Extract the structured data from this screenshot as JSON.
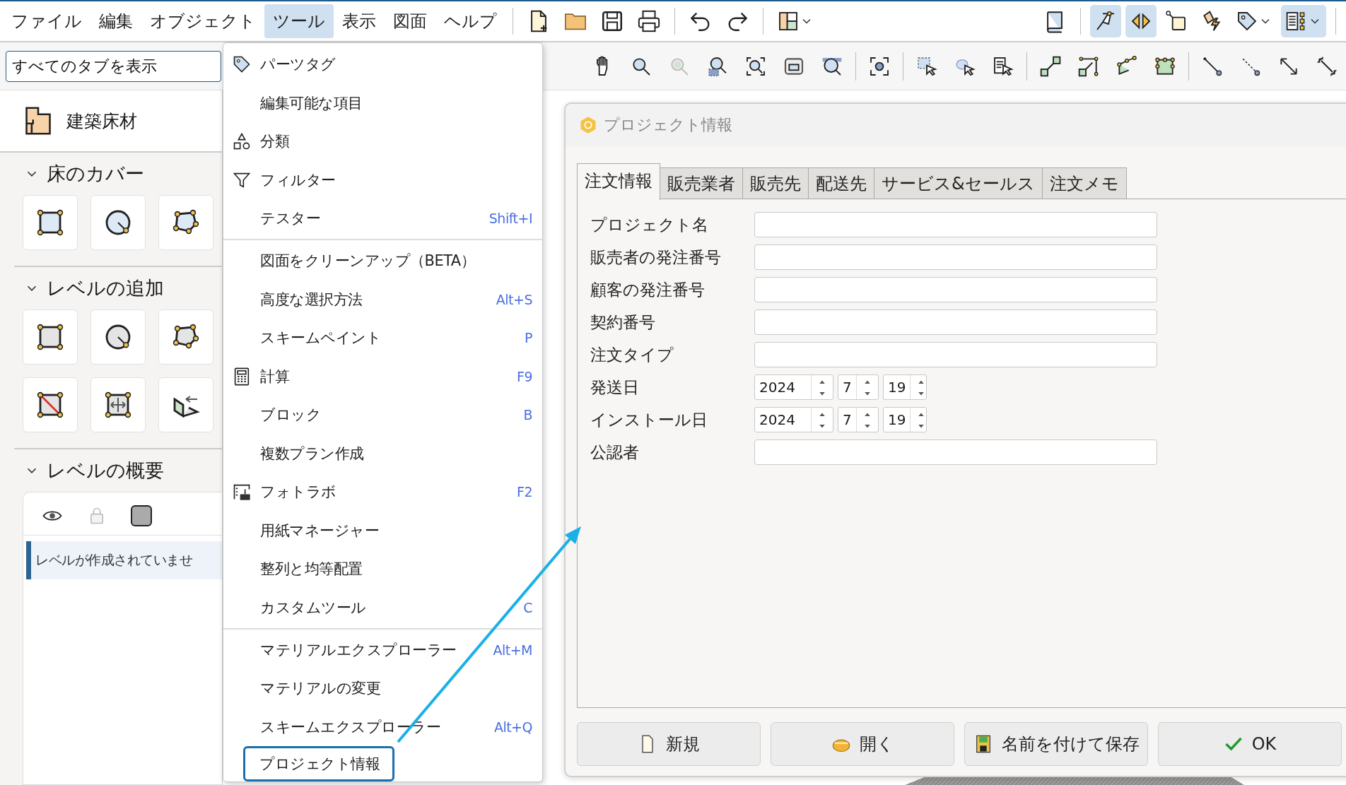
{
  "menu_bar": [
    {
      "label": "ファイル",
      "selected": false
    },
    {
      "label": "編集",
      "selected": false
    },
    {
      "label": "オブジェクト",
      "selected": false
    },
    {
      "label": "ツール",
      "selected": true
    },
    {
      "label": "表示",
      "selected": false
    },
    {
      "label": "図面",
      "selected": false
    },
    {
      "label": "ヘルプ",
      "selected": false
    }
  ],
  "toolbar": {
    "toggles": [
      {
        "selected": false
      },
      {
        "selected": true
      },
      {
        "selected": true
      },
      {
        "selected": false
      },
      {
        "selected": false
      },
      {
        "selected": false
      },
      {
        "selected": true
      }
    ]
  },
  "search": {
    "value": "すべてのタブを表示"
  },
  "sidebar": {
    "title": "建築床材",
    "sections": [
      {
        "title": "床のカバー",
        "expanded": true,
        "kind": "tools"
      },
      {
        "title": "レベルの追加",
        "expanded": true,
        "kind": "tools"
      },
      {
        "title": "レベルの概要",
        "expanded": true,
        "kind": "levels",
        "message": "レベルが作成されていませ"
      }
    ]
  },
  "tools_menu": {
    "sections": [
      {
        "items": [
          {
            "label": "パーツタグ",
            "selected": false
          },
          {
            "label": "編集可能な項目",
            "selected": false
          },
          {
            "label": "分類",
            "selected": false
          },
          {
            "label": "フィルター",
            "selected": false
          },
          {
            "label": "テスター",
            "shortcut": "Shift+I",
            "selected": false
          }
        ]
      },
      {
        "items": [
          {
            "label": "図面をクリーンアップ（BETA）",
            "selected": false
          },
          {
            "label": "高度な選択方法",
            "shortcut": "Alt+S",
            "selected": false
          },
          {
            "label": "スキームペイント",
            "shortcut": "P",
            "selected": false
          },
          {
            "label": "計算",
            "shortcut": "F9",
            "selected": false
          },
          {
            "label": "ブロック",
            "shortcut": "B",
            "selected": false
          },
          {
            "label": "複数プラン作成",
            "selected": false
          },
          {
            "label": "フォトラボ",
            "shortcut": "F2",
            "selected": false
          },
          {
            "label": "用紙マネージャー",
            "selected": false
          },
          {
            "label": "整列と均等配置",
            "selected": false
          },
          {
            "label": "カスタムツール",
            "shortcut": "C",
            "selected": false
          }
        ]
      },
      {
        "items": [
          {
            "label": "マテリアルエクスプローラー",
            "shortcut": "Alt+M",
            "selected": false
          },
          {
            "label": "マテリアルの変更",
            "selected": false
          },
          {
            "label": "スキームエクスプローラー",
            "shortcut": "Alt+Q",
            "selected": false
          },
          {
            "label": "プロジェクト情報",
            "selected": true
          }
        ]
      }
    ]
  },
  "dialog": {
    "title": "プロジェクト情報",
    "tabs": [
      {
        "label": "注文情報",
        "selected": true
      },
      {
        "label": "販売業者",
        "selected": false
      },
      {
        "label": "販売先",
        "selected": false
      },
      {
        "label": "配送先",
        "selected": false
      },
      {
        "label": "サービス&セールス",
        "selected": false
      },
      {
        "label": "注文メモ",
        "selected": false
      }
    ],
    "fields": [
      {
        "label": "プロジェクト名",
        "kind": "text"
      },
      {
        "label": "販売者の発注番号",
        "kind": "text"
      },
      {
        "label": "顧客の発注番号",
        "kind": "text"
      },
      {
        "label": "契約番号",
        "kind": "text"
      },
      {
        "label": "注文タイプ",
        "kind": "text"
      },
      {
        "label": "発送日",
        "kind": "date",
        "year": "2024",
        "month": "7",
        "day": "19"
      },
      {
        "label": "インストール日",
        "kind": "date",
        "year": "2024",
        "month": "7",
        "day": "19"
      },
      {
        "label": "公認者",
        "kind": "text"
      }
    ],
    "buttons": [
      {
        "label": "新規"
      },
      {
        "label": "開く"
      },
      {
        "label": "名前を付けて保存"
      },
      {
        "label": "OK"
      }
    ]
  }
}
